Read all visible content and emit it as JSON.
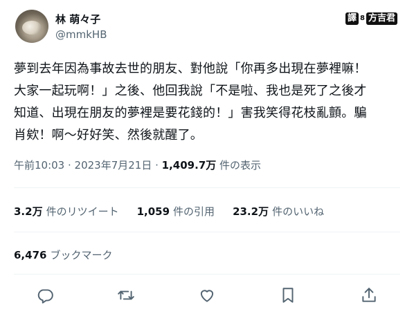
{
  "user": {
    "display_name": "林 萌々子",
    "handle": "@mmkHB"
  },
  "watermark": {
    "left": "譯",
    "dot": "8",
    "right": "方吉君"
  },
  "tweet": {
    "text": "夢到去年因為事故去世的朋友、對他說「你再多出現在夢裡嘛！\n大家一起玩啊！」之後、他回我說「不是啦、我也是死了之後才\n知道、出現在朋友的夢裡是要花錢的！」害我笑得花枝亂顫。騙\n肖欸！啊～好好笑、然後就醒了。"
  },
  "meta": {
    "time": "午前10:03",
    "sep1": " · ",
    "date": "2023年7月21日",
    "sep2": " · ",
    "views": "1,409.7万",
    "views_label": " 件の表示"
  },
  "stats": {
    "retweets": "3.2万",
    "retweets_label": "件のリツイート",
    "quotes": "1,059",
    "quotes_label": "件の引用",
    "likes": "23.2万",
    "likes_label": "件のいいね"
  },
  "bookmarks": {
    "count": "6,476",
    "label": "ブックマーク"
  },
  "actions": [
    "reply-icon",
    "retweet-icon",
    "like-icon",
    "bookmark-icon",
    "share-icon"
  ],
  "colors": {
    "text": "#0f1419",
    "secondary": "#536471",
    "divider": "#eff3f4"
  }
}
